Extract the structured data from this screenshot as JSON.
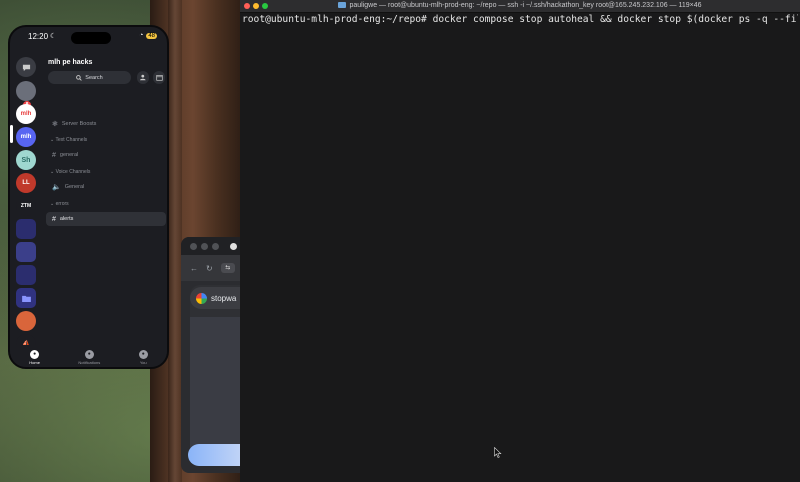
{
  "phone": {
    "status": {
      "time": "12:20",
      "moon": "☾",
      "wifi": "◔",
      "battery": "48"
    },
    "server_rail": [
      {
        "name": "dm",
        "label": "",
        "color": "#3a3c43"
      },
      {
        "name": "server-avatar",
        "label": "",
        "color": "#555",
        "badge": "8"
      },
      {
        "name": "mlh",
        "label": "mlh",
        "color": "#ffffff"
      },
      {
        "name": "mlh-pe",
        "label": "mlh",
        "color": "#5865f2"
      },
      {
        "name": "sh",
        "label": "Sh",
        "color": "#9fd7d0"
      },
      {
        "name": "ll",
        "label": "LL",
        "color": "#c0392b"
      },
      {
        "name": "ztm",
        "label": "ZTM",
        "color": "#1c1d22"
      },
      {
        "name": "folder-a",
        "label": "",
        "color": "#2b2d6e"
      },
      {
        "name": "folder-b",
        "label": "",
        "color": "#3b3f8a"
      },
      {
        "name": "folder-c",
        "label": "",
        "color": "#2b2d6e"
      },
      {
        "name": "folder-d",
        "label": "",
        "color": "#303280"
      },
      {
        "name": "cat",
        "label": "",
        "color": "#d9653b"
      },
      {
        "name": "ship",
        "label": "",
        "color": "#1c1d22"
      }
    ],
    "server_title": "mlh pe hacks",
    "search_label": "Search",
    "channels": {
      "boosts": "Server Boosts",
      "text_category": "Text Channels",
      "general_text": "general",
      "voice_category": "Voice Channels",
      "general_voice": "General",
      "errors_category": "errors",
      "alerts": "alerts"
    },
    "nav": {
      "home": "Home",
      "notifications": "Notifications",
      "you": "You"
    }
  },
  "browser": {
    "search_text": "stopwa"
  },
  "terminal": {
    "title": "pauligwe — root@ubuntu-mlh-prod-eng: ~/repo — ssh -i ~/.ssh/hackathon_key root@165.245.232.106 — 119×46",
    "prompt_line": "root@ubuntu-mlh-prod-eng:~/repo# docker compose stop autoheal && docker stop $(docker ps -q --filter name=web"
  }
}
